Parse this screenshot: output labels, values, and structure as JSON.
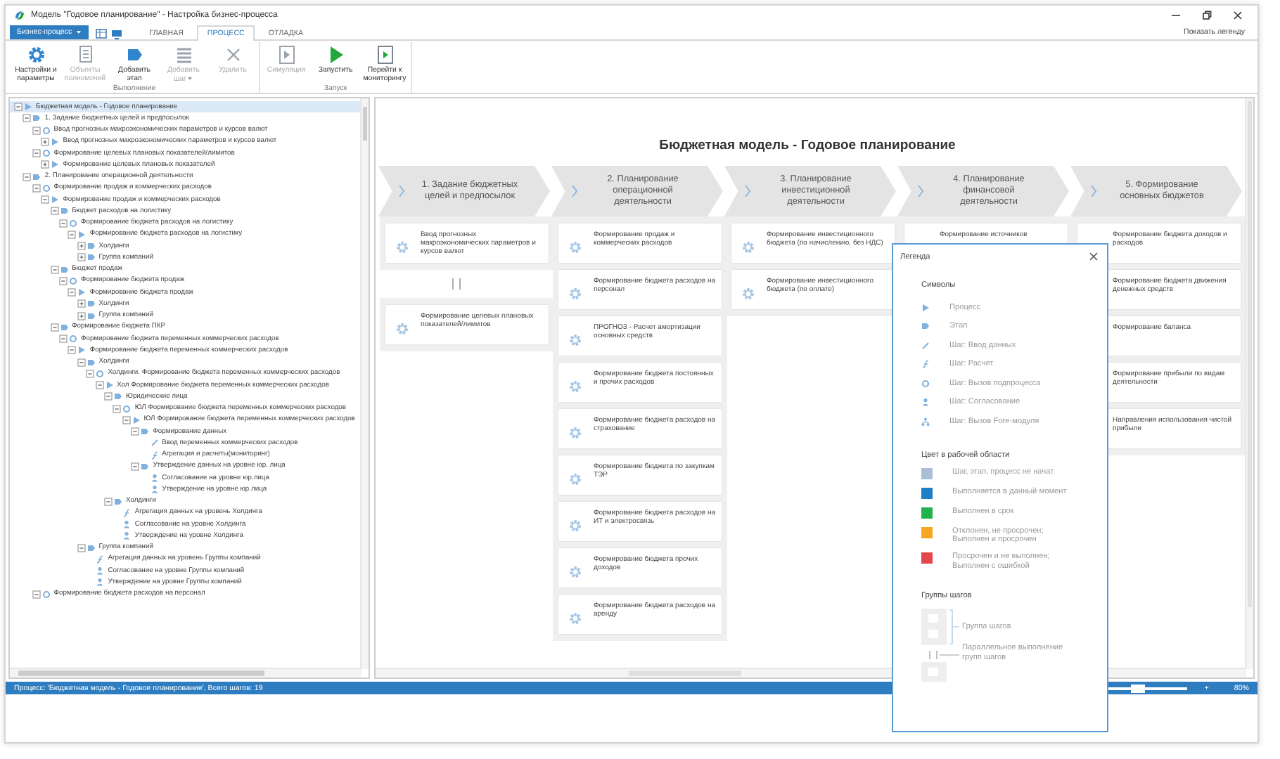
{
  "window": {
    "title": "Модель \"Годовое планирование\" - Настройка бизнес-процесса"
  },
  "app_menu": {
    "label": "Бизнес-процесс"
  },
  "tabs": [
    {
      "label": "ГЛАВНАЯ",
      "selected": false
    },
    {
      "label": "ПРОЦЕСС",
      "selected": true
    },
    {
      "label": "ОТЛАДКА",
      "selected": false
    }
  ],
  "show_legend": "Показать легенду",
  "ribbon": {
    "groups": [
      {
        "label": "Выполнение",
        "buttons": [
          {
            "kind": "settings",
            "label": "Настройки и параметры",
            "disabled": false,
            "dropdown": false
          },
          {
            "kind": "objects",
            "label": "Объекты полномочий",
            "disabled": true,
            "dropdown": false
          },
          {
            "kind": "add_stage",
            "label": "Добавить этап",
            "disabled": false,
            "dropdown": false
          },
          {
            "kind": "add_step",
            "label": "Добавить шаг",
            "disabled": true,
            "dropdown": true
          },
          {
            "kind": "delete",
            "label": "Удалить",
            "disabled": true,
            "dropdown": false
          }
        ]
      },
      {
        "label": "Запуск",
        "buttons": [
          {
            "kind": "simulate",
            "label": "Симуляция",
            "disabled": true,
            "dropdown": false
          },
          {
            "kind": "run",
            "label": "Запустить",
            "disabled": false,
            "dropdown": false
          },
          {
            "kind": "monitor",
            "label": "Перейти к мониторингу",
            "disabled": false,
            "dropdown": false
          }
        ]
      }
    ]
  },
  "tree": {
    "items": [
      {
        "label": "Бюджетная модель - Годовое планирование",
        "kind": "process",
        "expanded": true,
        "selected": true,
        "children": [
          {
            "label": "1. Задание бюджетных целей и предпосылок",
            "kind": "stage",
            "expanded": true,
            "selected": false,
            "children": [
              {
                "label": "Ввод прогнозных макроэкономических параметров и курсов валют",
                "kind": "subprocess",
                "expanded": true,
                "selected": false,
                "children": [
                  {
                    "label": "Ввод прогнозных макроэкономических параметров и курсов валют",
                    "kind": "process",
                    "expanded": false,
                    "selected": false
                  }
                ]
              },
              {
                "label": "Формирование целевых плановых показателей/лимитов",
                "kind": "subprocess",
                "expanded": true,
                "selected": false,
                "children": [
                  {
                    "label": "Формирование целевых плановых показателей",
                    "kind": "process",
                    "expanded": false,
                    "selected": false
                  }
                ]
              }
            ]
          },
          {
            "label": "2. Планирование операционной деятельности",
            "kind": "stage",
            "expanded": true,
            "selected": false,
            "children": [
              {
                "label": "Формирование продаж и коммерческих расходов",
                "kind": "subprocess",
                "expanded": true,
                "selected": false,
                "children": [
                  {
                    "label": "Формирование продаж и коммерческих расходов",
                    "kind": "process",
                    "expanded": true,
                    "selected": false,
                    "children": [
                      {
                        "label": "Бюджет расходов на логистику",
                        "kind": "stage",
                        "expanded": true,
                        "selected": false,
                        "children": [
                          {
                            "label": "Формирование бюджета расходов на логистику",
                            "kind": "subprocess",
                            "expanded": true,
                            "selected": false,
                            "children": [
                              {
                                "label": "Формирование бюджета расходов на логистику",
                                "kind": "process",
                                "expanded": true,
                                "selected": false,
                                "children": [
                                  {
                                    "label": "Холдинги",
                                    "kind": "stage",
                                    "expanded": false,
                                    "selected": false
                                  },
                                  {
                                    "label": "Группа компаний",
                                    "kind": "stage",
                                    "expanded": false,
                                    "selected": false
                                  }
                                ]
                              }
                            ]
                          }
                        ]
                      },
                      {
                        "label": "Бюджет продаж",
                        "kind": "stage",
                        "expanded": true,
                        "selected": false,
                        "children": [
                          {
                            "label": "Формирование бюджета продаж",
                            "kind": "subprocess",
                            "expanded": true,
                            "selected": false,
                            "children": [
                              {
                                "label": "Формирование бюджета продаж",
                                "kind": "process",
                                "expanded": true,
                                "selected": false,
                                "children": [
                                  {
                                    "label": "Холдинги",
                                    "kind": "stage",
                                    "expanded": false,
                                    "selected": false
                                  },
                                  {
                                    "label": "Группа компаний",
                                    "kind": "stage",
                                    "expanded": false,
                                    "selected": false
                                  }
                                ]
                              }
                            ]
                          }
                        ]
                      },
                      {
                        "label": "Формирование бюджета ПКР",
                        "kind": "stage",
                        "expanded": true,
                        "selected": false,
                        "children": [
                          {
                            "label": "Формирование бюджета переменных коммерческих расходов",
                            "kind": "subprocess",
                            "expanded": true,
                            "selected": false,
                            "children": [
                              {
                                "label": "Формирование бюджета переменных коммерческих расходов",
                                "kind": "process",
                                "expanded": true,
                                "selected": false,
                                "children": [
                                  {
                                    "label": "Холдинги",
                                    "kind": "stage",
                                    "expanded": true,
                                    "selected": false,
                                    "children": [
                                      {
                                        "label": "Холдинги. Формирование бюджета переменных коммерческих расходов",
                                        "kind": "subprocess",
                                        "expanded": true,
                                        "selected": false,
                                        "children": [
                                          {
                                            "label": "Хол Формирование бюджета переменных коммерческих расходов",
                                            "kind": "process",
                                            "expanded": true,
                                            "selected": false,
                                            "children": [
                                              {
                                                "label": "Юридические лица",
                                                "kind": "stage",
                                                "expanded": true,
                                                "selected": false,
                                                "children": [
                                                  {
                                                    "label": "ЮЛ Формирование бюджета переменных коммерческих расходов",
                                                    "kind": "subprocess",
                                                    "expanded": true,
                                                    "selected": false,
                                                    "children": [
                                                      {
                                                        "label": "ЮЛ Формирование бюджета переменных коммерческих расходов",
                                                        "kind": "process",
                                                        "expanded": true,
                                                        "selected": false,
                                                        "children": [
                                                          {
                                                            "label": "Формирование данных",
                                                            "kind": "stage",
                                                            "expanded": true,
                                                            "selected": false,
                                                            "children": [
                                                              {
                                                                "label": "Ввод переменных коммерческих расходов",
                                                                "kind": "input",
                                                                "selected": false
                                                              },
                                                              {
                                                                "label": "Агрегация и расчеты(мониторинг)",
                                                                "kind": "calc",
                                                                "selected": false
                                                              }
                                                            ]
                                                          },
                                                          {
                                                            "label": "Утверждение данных на уровне юр. лица",
                                                            "kind": "stage",
                                                            "expanded": true,
                                                            "selected": false,
                                                            "children": [
                                                              {
                                                                "label": "Согласование на уровне юр.лица",
                                                                "kind": "approve",
                                                                "selected": false
                                                              },
                                                              {
                                                                "label": "Утверждение на уровне юр.лица",
                                                                "kind": "approve",
                                                                "selected": false
                                                              }
                                                            ]
                                                          }
                                                        ]
                                                      }
                                                    ]
                                                  }
                                                ]
                                              },
                                              {
                                                "label": "Холдинги",
                                                "kind": "stage",
                                                "expanded": true,
                                                "selected": false,
                                                "children": [
                                                  {
                                                    "label": "Агрегация данных на уровень Холдинга",
                                                    "kind": "calc",
                                                    "selected": false
                                                  },
                                                  {
                                                    "label": "Согласование на уровне Холдинга",
                                                    "kind": "approve",
                                                    "selected": false
                                                  },
                                                  {
                                                    "label": "Утверждение на уровне Холдинга",
                                                    "kind": "approve",
                                                    "selected": false
                                                  }
                                                ]
                                              }
                                            ]
                                          }
                                        ]
                                      }
                                    ]
                                  },
                                  {
                                    "label": "Группа компаний",
                                    "kind": "stage",
                                    "expanded": true,
                                    "selected": false,
                                    "children": [
                                      {
                                        "label": "Агрегация данных на уровень Группы компаний",
                                        "kind": "calc",
                                        "selected": false
                                      },
                                      {
                                        "label": "Согласование на уровне Группы компаний",
                                        "kind": "approve",
                                        "selected": false
                                      },
                                      {
                                        "label": "Утверждение на уровне Группы компаний",
                                        "kind": "approve",
                                        "selected": false
                                      }
                                    ]
                                  }
                                ]
                              }
                            ]
                          }
                        ]
                      }
                    ]
                  }
                ]
              },
              {
                "label": "Формирование бюджета расходов на персонал",
                "kind": "subprocess",
                "expanded": true,
                "selected": false
              }
            ]
          }
        ]
      }
    ]
  },
  "diagram": {
    "title": "Бюджетная модель - Годовое планирование",
    "columns": [
      {
        "title": "1. Задание бюджетных целей и предпосылок",
        "groups": [
          {
            "cards": [
              {
                "label": "Ввод прогнозных макроэкономических параметров и курсов валют"
              }
            ]
          },
          {
            "cards": [
              {
                "label": "Формирование целевых плановых показателей/лимитов"
              }
            ]
          }
        ]
      },
      {
        "title": "2. Планирование операционной деятельности",
        "groups": [
          {
            "cards": [
              {
                "label": "Формирование продаж и коммерческих расходов"
              },
              {
                "label": "Формирование бюджета расходов на персонал"
              },
              {
                "label": "ПРОГНОЗ - Расчет амортизации основных средств"
              },
              {
                "label": "Формирование бюджета постоянных и прочих расходов"
              },
              {
                "label": "Формирование бюджета расходов на страхование"
              },
              {
                "label": "Формирование бюджета по закупкам ТЭР"
              },
              {
                "label": "Формирование бюджета расходов на ИТ и электросвязь"
              },
              {
                "label": "Формирование бюджета прочих доходов"
              },
              {
                "label": "Формирование бюджета расходов на аренду"
              }
            ]
          }
        ]
      },
      {
        "title": "3. Планирование инвестиционной деятельности",
        "groups": [
          {
            "cards": [
              {
                "label": "Формирование инвестиционного бюджета (по начислению, без НДС)"
              },
              {
                "label": "Формирование инвестиционного бюджета (по оплате)"
              }
            ]
          }
        ]
      },
      {
        "title": "4. Планирование финансовой деятельности",
        "groups": [
          {
            "cards": [
              {
                "label": "Формирование источников"
              }
            ]
          }
        ]
      },
      {
        "title": "5. Формирование основных бюджетов",
        "groups": [
          {
            "cards": [
              {
                "label": "Формирование бюджета доходов и расходов"
              },
              {
                "label": "Формирование бюджета движения денежных средств"
              },
              {
                "label": "Формирование баланса"
              },
              {
                "label": "Формирование прибыли по видам деятельности"
              },
              {
                "label": "Направления использования чистой прибыли"
              }
            ]
          }
        ]
      }
    ]
  },
  "legend": {
    "title": "Легенда",
    "symbols_title": "Символы",
    "symbols": [
      {
        "kind": "process",
        "label": "Процесс"
      },
      {
        "kind": "stage",
        "label": "Этап"
      },
      {
        "kind": "input",
        "label": "Шаг: Ввод данных"
      },
      {
        "kind": "calc",
        "label": "Шаг: Расчет"
      },
      {
        "kind": "subprocess",
        "label": "Шаг: Вызов подпроцесса"
      },
      {
        "kind": "approve",
        "label": "Шаг: Согласование"
      },
      {
        "kind": "fore",
        "label": "Шаг: Вызов Fore-модуля"
      }
    ],
    "colors_title": "Цвет в рабочей области",
    "colors": [
      {
        "color": "#a9bfd8",
        "label": "Шаг, этап, процесс не начат"
      },
      {
        "color": "#1f7ec8",
        "label": "Выполняется в данный момент"
      },
      {
        "color": "#22b24c",
        "label": "Выполнен в срок"
      },
      {
        "color": "#f6a623",
        "label": "Отклонен, не просрочен;\nВыполнен и просрочен"
      },
      {
        "color": "#e2474b",
        "label": "Просрочен и не выполнен;\nВыполнен с ошибкой"
      }
    ],
    "groups_title": "Группы шагов",
    "group_label": "Группа шагов",
    "parallel_label": "Параллельное выполнение групп шагов"
  },
  "status_bar": {
    "text": "Процесс: 'Бюджетная модель - Годовое планирование', Всего шагов: 19",
    "zoom": {
      "level": 0.42
    },
    "zoom_in": "+",
    "zoom_value": "80%"
  }
}
